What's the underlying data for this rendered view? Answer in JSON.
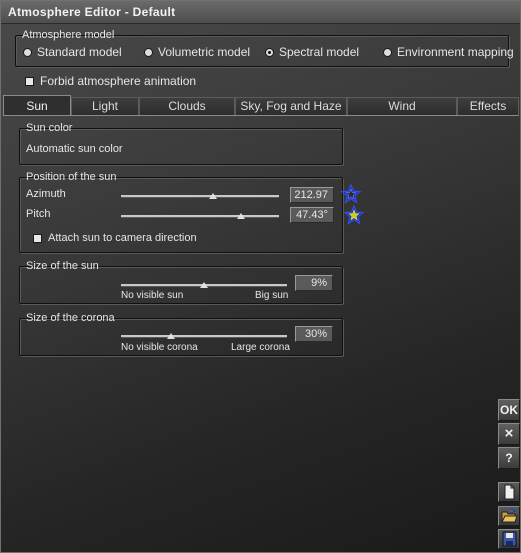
{
  "window": {
    "title": "Atmosphere Editor - Default"
  },
  "atmosphere_model": {
    "title": "Atmosphere model",
    "options": [
      {
        "label": "Standard model",
        "selected": false
      },
      {
        "label": "Volumetric model",
        "selected": false
      },
      {
        "label": "Spectral model",
        "selected": true
      },
      {
        "label": "Environment mapping",
        "selected": false
      }
    ]
  },
  "forbid_animation": {
    "label": "Forbid atmosphere animation",
    "checked": false
  },
  "tabs": [
    {
      "label": "Sun",
      "active": true
    },
    {
      "label": "Light",
      "active": false
    },
    {
      "label": "Clouds",
      "active": false
    },
    {
      "label": "Sky, Fog and Haze",
      "active": false
    },
    {
      "label": "Wind",
      "active": false
    },
    {
      "label": "Effects",
      "active": false
    }
  ],
  "sun_color": {
    "title": "Sun color",
    "value": "Automatic sun color"
  },
  "position": {
    "title": "Position of the sun",
    "azimuth": {
      "label": "Azimuth",
      "value": "212.97",
      "slider_fraction": 0.58
    },
    "pitch": {
      "label": "Pitch",
      "value": "47.43°",
      "slider_fraction": 0.75
    },
    "attach": {
      "label": "Attach sun to camera direction",
      "checked": false
    }
  },
  "sun_size": {
    "title": "Size of the sun",
    "value": "9%",
    "slider_fraction": 0.5,
    "min_label": "No visible sun",
    "max_label": "Big sun"
  },
  "corona_size": {
    "title": "Size of the corona",
    "value": "30%",
    "slider_fraction": 0.3,
    "min_label": "No visible corona",
    "max_label": "Large corona"
  },
  "side_buttons": {
    "ok": "OK",
    "close": "×",
    "help": "?"
  },
  "icons": [
    "star-icon",
    "new-file-icon",
    "open-folder-icon",
    "save-disk-icon"
  ]
}
